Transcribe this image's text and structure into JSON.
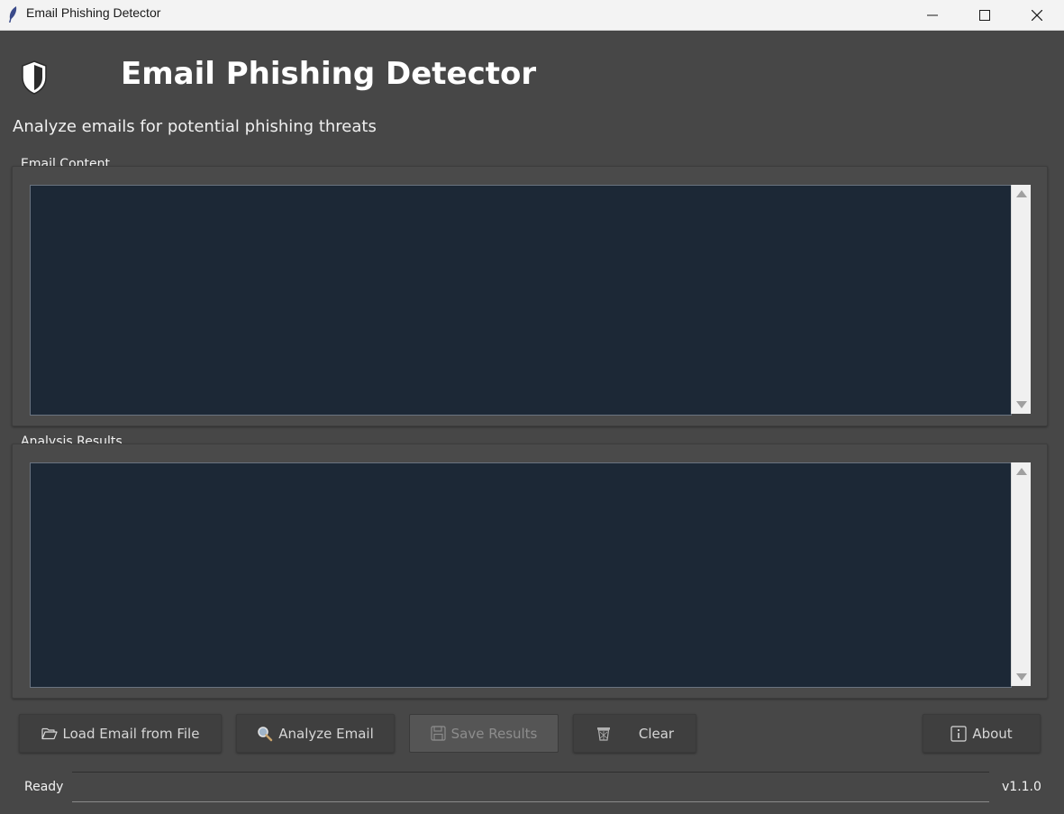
{
  "window": {
    "title": "Email Phishing Detector",
    "controls": {
      "minimize_icon": "minimize-icon",
      "maximize_icon": "maximize-icon",
      "close_icon": "close-icon"
    }
  },
  "header": {
    "icon": "shield-icon",
    "title": "Email Phishing Detector",
    "subtitle": "Analyze emails for potential phishing threats"
  },
  "email_content": {
    "label": "Email Content",
    "value": ""
  },
  "analysis_results": {
    "label": "Analysis Results",
    "value": ""
  },
  "toolbar": {
    "load_label": "Load Email from File",
    "analyze_label": "Analyze Email",
    "save_label": "Save Results",
    "clear_label": "Clear",
    "about_label": "About"
  },
  "status": {
    "text": "Ready",
    "version": "v1.1.0"
  },
  "colors": {
    "background": "#474747",
    "text_area": "#1c2836",
    "accent_text": "#ffffff"
  }
}
